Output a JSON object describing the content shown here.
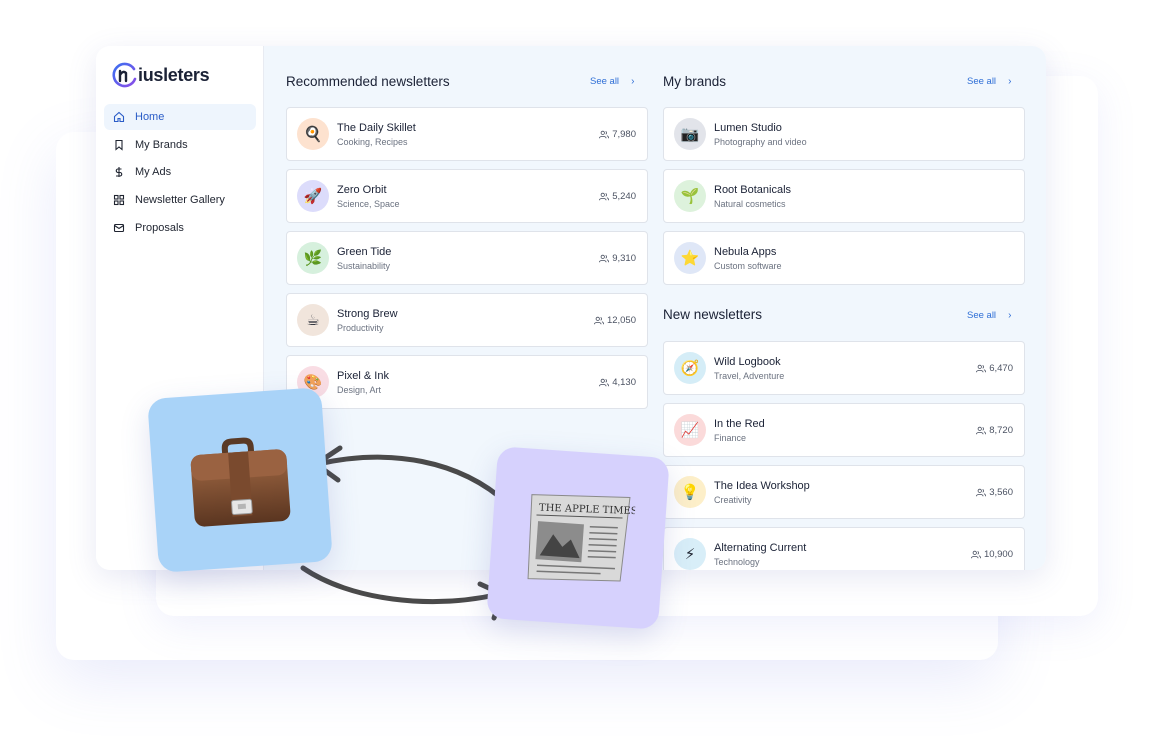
{
  "brand": {
    "logo_text": "iusleters"
  },
  "sidebar": {
    "items": [
      {
        "label": "Home",
        "icon": "home-icon",
        "active": true
      },
      {
        "label": "My Brands",
        "icon": "bookmark-icon",
        "active": false
      },
      {
        "label": "My Ads",
        "icon": "dollar-icon",
        "active": false
      },
      {
        "label": "Newsletter Gallery",
        "icon": "grid-icon",
        "active": false
      },
      {
        "label": "Proposals",
        "icon": "mail-icon",
        "active": false
      }
    ]
  },
  "recommended": {
    "title": "Recommended newsletters",
    "see_all": "See all",
    "items": [
      {
        "title": "The Daily Skillet",
        "subtitle": "Cooking, Recipes",
        "count": "7,980",
        "emoji": "🍳",
        "bg": "#fde2cf"
      },
      {
        "title": "Zero Orbit",
        "subtitle": "Science, Space",
        "count": "5,240",
        "emoji": "🚀",
        "bg": "#dcdcfb"
      },
      {
        "title": "Green Tide",
        "subtitle": "Sustainability",
        "count": "9,310",
        "emoji": "🌿",
        "bg": "#d6f0dd"
      },
      {
        "title": "Strong Brew",
        "subtitle": "Productivity",
        "count": "12,050",
        "emoji": "☕",
        "bg": "#f1e5dc"
      },
      {
        "title": "Pixel & Ink",
        "subtitle": "Design, Art",
        "count": "4,130",
        "emoji": "🎨",
        "bg": "#f9dde4"
      }
    ]
  },
  "brands": {
    "title": "My brands",
    "see_all": "See all",
    "items": [
      {
        "title": "Lumen Studio",
        "subtitle": "Photography and video",
        "emoji": "📷",
        "bg": "#e2e4ea"
      },
      {
        "title": "Root Botanicals",
        "subtitle": "Natural cosmetics",
        "emoji": "🌱",
        "bg": "#ddf2dc"
      },
      {
        "title": "Nebula Apps",
        "subtitle": "Custom software",
        "emoji": "⭐",
        "bg": "#dfe7f7"
      }
    ]
  },
  "new_newsletters": {
    "title": "New newsletters",
    "see_all": "See all",
    "items": [
      {
        "title": "Wild Logbook",
        "subtitle": "Travel, Adventure",
        "count": "6,470",
        "emoji": "🧭",
        "bg": "#d5edf7"
      },
      {
        "title": "In the Red",
        "subtitle": "Finance",
        "count": "8,720",
        "emoji": "📈",
        "bg": "#fbdada"
      },
      {
        "title": "The Idea Workshop",
        "subtitle": "Creativity",
        "count": "3,560",
        "emoji": "💡",
        "bg": "#fdefc9"
      },
      {
        "title": "Alternating Current",
        "subtitle": "Technology",
        "count": "10,900",
        "emoji": "⚡",
        "bg": "#d8eef8"
      }
    ]
  },
  "colors": {
    "accent": "#2f6fd6",
    "active_bg": "#eef5fd",
    "main_bg": "#f1f7fd"
  }
}
